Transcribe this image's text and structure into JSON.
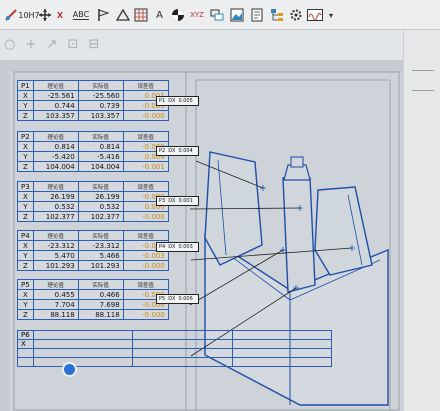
{
  "toolbar": {
    "items": [
      {
        "name": "measure-tool-icon",
        "label": ""
      },
      {
        "name": "coordinate-tool-icon",
        "label": "10H7"
      },
      {
        "name": "move-tool-icon",
        "label": ""
      },
      {
        "name": "axis-x-icon",
        "label": "X"
      },
      {
        "name": "text-abc-icon",
        "label": "ABC"
      },
      {
        "name": "flag-icon",
        "label": ""
      },
      {
        "name": "triangle-icon",
        "label": ""
      },
      {
        "name": "grid-icon",
        "label": ""
      },
      {
        "name": "angle-icon",
        "label": "A"
      },
      {
        "name": "color-wheel-icon",
        "label": ""
      },
      {
        "name": "xyz-icon",
        "label": "XYZ"
      },
      {
        "name": "layers-icon",
        "label": ""
      },
      {
        "name": "image-icon",
        "label": ""
      },
      {
        "name": "document-icon",
        "label": ""
      },
      {
        "name": "tree-icon",
        "label": ""
      },
      {
        "name": "gear-icon",
        "label": ""
      },
      {
        "name": "wave-icon",
        "label": ""
      },
      {
        "name": "chevron-down-icon",
        "label": "▾"
      }
    ]
  },
  "points": [
    {
      "label": "P1",
      "headers": [
        "理论值",
        "实际值",
        "误差值"
      ],
      "rows": [
        [
          "X",
          "-25.561",
          "-25.560",
          "0.001"
        ],
        [
          "Y",
          "0.744",
          "0.739",
          "-0.005"
        ],
        [
          "Z",
          "103.357",
          "103.357",
          "-0.000"
        ]
      ]
    },
    {
      "label": "P2",
      "headers": [
        "理论值",
        "实际值",
        "误差值"
      ],
      "rows": [
        [
          "X",
          "0.814",
          "0.814",
          "-0.000"
        ],
        [
          "Y",
          "-5.420",
          "-5.416",
          "0.004"
        ],
        [
          "Z",
          "104.004",
          "104.004",
          "-0.001"
        ]
      ]
    },
    {
      "label": "P3",
      "headers": [
        "理论值",
        "实际值",
        "误差值"
      ],
      "rows": [
        [
          "X",
          "26.199",
          "26.199",
          "-0.000"
        ],
        [
          "Y",
          "0.532",
          "0.532",
          "0.000"
        ],
        [
          "Z",
          "102.377",
          "102.377",
          "-0.000"
        ]
      ]
    },
    {
      "label": "P4",
      "headers": [
        "理论值",
        "实际值",
        "误差值"
      ],
      "rows": [
        [
          "X",
          "-23.312",
          "-23.312",
          "-0.000"
        ],
        [
          "Y",
          "5.470",
          "5.466",
          "-0.003"
        ],
        [
          "Z",
          "101.293",
          "101.293",
          "-0.000"
        ]
      ]
    },
    {
      "label": "P5",
      "headers": [
        "理论值",
        "实际值",
        "误差值"
      ],
      "rows": [
        [
          "X",
          "0.455",
          "0.466",
          "-0.000"
        ],
        [
          "Y",
          "7.704",
          "7.698",
          "-0.006"
        ],
        [
          "Z",
          "88.118",
          "88.118",
          "-0.000"
        ]
      ]
    }
  ],
  "p6": {
    "label": "P6",
    "axis": "X"
  },
  "callouts": [
    {
      "name": "P1",
      "axis": "DX",
      "value": "0.005"
    },
    {
      "name": "P2",
      "axis": "DX",
      "value": "0.004"
    },
    {
      "name": "P3",
      "axis": "DX",
      "value": "0.001"
    },
    {
      "name": "P4",
      "axis": "DX",
      "value": "0.003"
    },
    {
      "name": "P5",
      "axis": "DX",
      "value": "0.006"
    }
  ],
  "colors": {
    "table_border": "#1f4fa8",
    "deviation": "#d08a10",
    "model_line": "#1f4fa8"
  }
}
